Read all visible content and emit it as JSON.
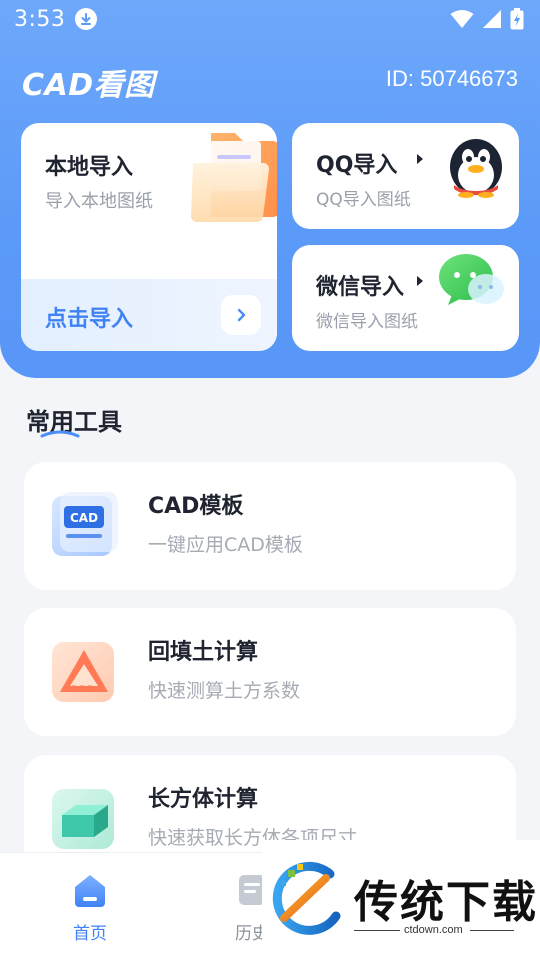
{
  "status_bar": {
    "time": "3:53"
  },
  "header": {
    "app_title": "CAD看图",
    "user_id": "ID: 50746673"
  },
  "import_cards": {
    "local": {
      "title": "本地导入",
      "subtitle": "导入本地图纸",
      "cta": "点击导入"
    },
    "qq": {
      "title": "QQ导入",
      "subtitle": "QQ导入图纸"
    },
    "wechat": {
      "title": "微信导入",
      "subtitle": "微信导入图纸"
    }
  },
  "section": {
    "title": "常用工具"
  },
  "tools": [
    {
      "name": "CAD模板",
      "desc": "一键应用CAD模板",
      "icon_text": "CAD"
    },
    {
      "name": "回填土计算",
      "desc": "快速测算土方系数"
    },
    {
      "name": "长方体计算",
      "desc": "快速获取长方体各项尺寸"
    }
  ],
  "bottom_nav": {
    "home": "首页",
    "history": "历史"
  },
  "watermark": {
    "text": "传统下载",
    "url": "ctdown.com"
  },
  "colors": {
    "accent": "#3f82f5",
    "header": "#5b9af8"
  }
}
